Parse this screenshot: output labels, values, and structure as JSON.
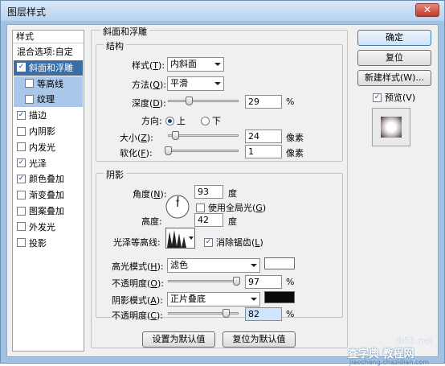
{
  "window": {
    "title": "图层样式",
    "close_glyph": "✕"
  },
  "styles_list": {
    "header": "样式",
    "items": [
      {
        "label": "混合选项:自定",
        "checkbox": false,
        "checked": false,
        "state": "normal"
      },
      {
        "label": "斜面和浮雕",
        "checkbox": true,
        "checked": true,
        "state": "selected"
      },
      {
        "label": "等高线",
        "checkbox": true,
        "checked": false,
        "state": "sub"
      },
      {
        "label": "纹理",
        "checkbox": true,
        "checked": false,
        "state": "sub"
      },
      {
        "label": "描边",
        "checkbox": true,
        "checked": true,
        "state": "normal"
      },
      {
        "label": "内阴影",
        "checkbox": true,
        "checked": false,
        "state": "normal"
      },
      {
        "label": "内发光",
        "checkbox": true,
        "checked": false,
        "state": "normal"
      },
      {
        "label": "光泽",
        "checkbox": true,
        "checked": true,
        "state": "normal"
      },
      {
        "label": "颜色叠加",
        "checkbox": true,
        "checked": true,
        "state": "normal"
      },
      {
        "label": "渐变叠加",
        "checkbox": true,
        "checked": false,
        "state": "normal"
      },
      {
        "label": "图案叠加",
        "checkbox": true,
        "checked": false,
        "state": "normal"
      },
      {
        "label": "外发光",
        "checkbox": true,
        "checked": false,
        "state": "normal"
      },
      {
        "label": "投影",
        "checkbox": true,
        "checked": false,
        "state": "normal"
      }
    ]
  },
  "bevel": {
    "group_title": "斜面和浮雕",
    "structure_title": "结构",
    "style": {
      "label": "样式",
      "key": "T",
      "value": "内斜面"
    },
    "technique": {
      "label": "方法",
      "key": "Q",
      "value": "平滑"
    },
    "depth": {
      "label": "深度",
      "key": "D",
      "value": "29",
      "unit": "%",
      "level": 0.29
    },
    "direction": {
      "label": "方向:",
      "options": [
        "上",
        "下"
      ],
      "selected": "上"
    },
    "size": {
      "label": "大小",
      "key": "Z",
      "value": "24",
      "unit": "像素",
      "level": 0.1
    },
    "soften": {
      "label": "软化",
      "key": "F",
      "value": "1",
      "unit": "像素",
      "level": 0.0
    }
  },
  "shading": {
    "title": "阴影",
    "angle": {
      "label": "角度",
      "key": "N",
      "value": "93",
      "unit": "度"
    },
    "global_light": {
      "label": "使用全局光",
      "key": "G",
      "checked": false
    },
    "altitude": {
      "label": "高度:",
      "value": "42",
      "unit": "度"
    },
    "gloss_contour": {
      "label": "光泽等高线:",
      "anti_alias_label": "消除锯齿",
      "anti_alias_key": "L",
      "anti_alias_checked": true
    },
    "highlight_mode": {
      "label": "高光模式",
      "key": "H",
      "value": "滤色",
      "color": "#ffffff"
    },
    "highlight_opacity": {
      "label": "不透明度",
      "key": "O",
      "value": "97",
      "unit": "%",
      "level": 0.97
    },
    "shadow_mode": {
      "label": "阴影模式",
      "key": "A",
      "value": "正片叠底",
      "color": "#0a0a0a"
    },
    "shadow_opacity": {
      "label": "不透明度",
      "key": "C",
      "value": "82",
      "unit": "%",
      "level": 0.82
    }
  },
  "bottom_buttons": {
    "make_default": "设置为默认值",
    "reset_default": "复位为默认值"
  },
  "side": {
    "ok": "确定",
    "reset": "复位",
    "new_style": "新建样式(W)...",
    "preview_label": "预览(V)",
    "preview_checked": true
  },
  "watermark": {
    "line1": "jb51.net",
    "line2": "查字典 教程网",
    "line3": "jiaocheng.chazidian.com"
  },
  "colors": {
    "accent": "#3a6ea5",
    "sub_highlight": "#a9c7e8",
    "titlebar": "#c5daf0"
  }
}
